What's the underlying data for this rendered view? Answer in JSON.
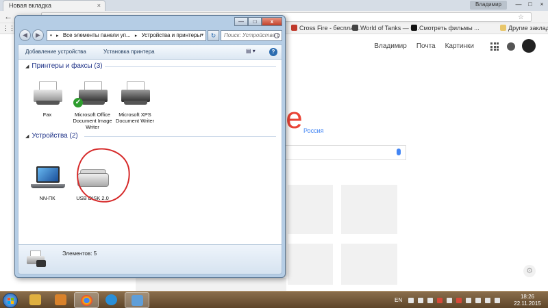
{
  "browser": {
    "tab_title": "Новая вкладка",
    "tab_close": "×",
    "user_name": "Владимир",
    "window_controls": [
      "—",
      "□",
      "×"
    ],
    "back_icon": "arrow-left-icon",
    "bookmarks": [
      {
        "label": "Cross Fire - бесплат...",
        "color": "#c0392b"
      },
      {
        "label": "World of Tanks — б...",
        "color": "#444444"
      },
      {
        "label": "Смотреть фильмы ...",
        "color": "#111111"
      }
    ],
    "other_bookmarks": "Другие закладки"
  },
  "google": {
    "links": [
      "Владимир",
      "Почта",
      "Картинки"
    ],
    "logo_visible": "gle",
    "region": "Россия",
    "settings_icon": "gear-icon"
  },
  "control_panel": {
    "caption_buttons": [
      "—",
      "□",
      "x"
    ],
    "nav_back": "◀",
    "nav_forward": "▶",
    "address": {
      "root": "Все элементы панели уп...",
      "current": "Устройства и принтеры",
      "arrow": "▸",
      "dropdown": "▾"
    },
    "refresh": "↻",
    "search_placeholder": "Поиск: Устройства и ...",
    "commands": {
      "add_device": "Добавление устройства",
      "add_printer": "Установка принтера"
    },
    "view_glyph": "▤ ▾",
    "help": "?",
    "groups": {
      "printers": "Принтеры и факсы (3)",
      "devices": "Устройства (2)"
    },
    "printers": [
      {
        "name": "Fax"
      },
      {
        "name": "Microsoft Office Document Image Writer",
        "default": true
      },
      {
        "name": "Microsoft XPS Document Writer"
      }
    ],
    "devices": [
      {
        "name": "NN-ПК"
      },
      {
        "name": "USB DISK 2.0"
      }
    ],
    "status": "Элементов: 5"
  },
  "taskbar": {
    "lang": "EN",
    "time": "18:26",
    "date": "22.11.2015",
    "apps": [
      {
        "name": "explorer",
        "color": "#e0b040"
      },
      {
        "name": "media-player",
        "color": "#d9822b"
      },
      {
        "name": "chrome",
        "color": "#4285f4"
      },
      {
        "name": "internet-explorer",
        "color": "#2a8fd8"
      },
      {
        "name": "control-panel",
        "color": "#5f9ed8"
      }
    ]
  }
}
